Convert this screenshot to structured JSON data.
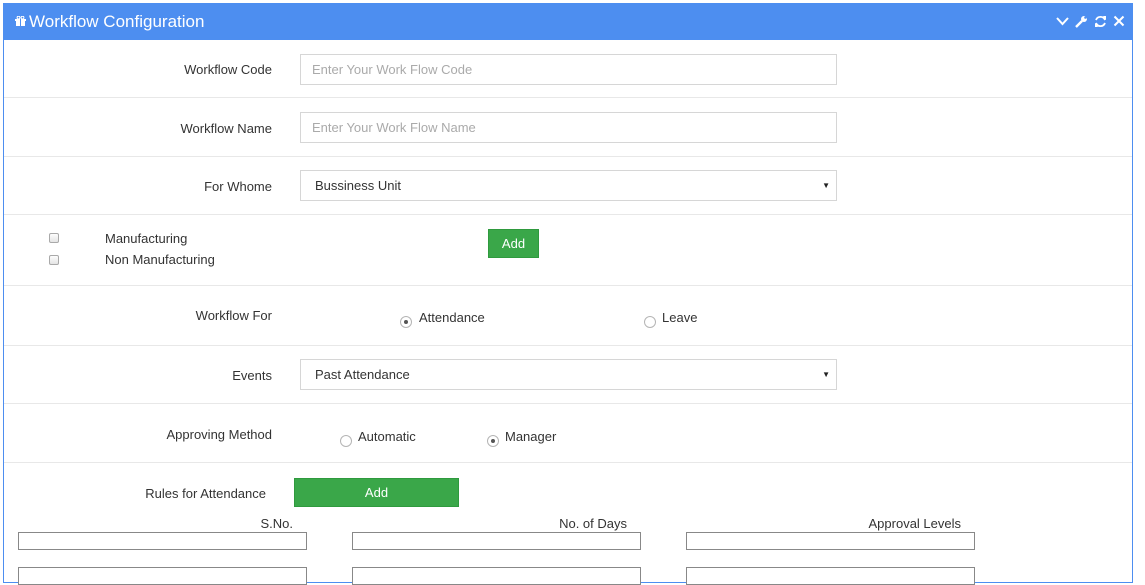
{
  "panel": {
    "title": "Workflow Configuration",
    "icon": "gift-icon",
    "tools": [
      "collapse-icon",
      "wrench-icon",
      "refresh-icon",
      "close-icon"
    ]
  },
  "form": {
    "workflow_code": {
      "label": "Workflow Code",
      "placeholder": "Enter Your Work Flow Code",
      "value": ""
    },
    "workflow_name": {
      "label": "Workflow Name",
      "placeholder": "Enter Your Work Flow Name",
      "value": ""
    },
    "for_whome": {
      "label": "For Whome",
      "selected": "Bussiness Unit"
    },
    "units": {
      "options": [
        {
          "label": "Manufacturing",
          "checked": false
        },
        {
          "label": "Non Manufacturing",
          "checked": false
        }
      ],
      "add_label": "Add"
    },
    "workflow_for": {
      "label": "Workflow For",
      "options": [
        {
          "label": "Attendance",
          "selected": true
        },
        {
          "label": "Leave",
          "selected": false
        }
      ]
    },
    "events": {
      "label": "Events",
      "selected": "Past Attendance"
    },
    "approving_method": {
      "label": "Approving Method",
      "options": [
        {
          "label": "Automatic",
          "selected": false
        },
        {
          "label": "Manager",
          "selected": true
        }
      ]
    },
    "rules": {
      "label": "Rules for Attendance",
      "add_label": "Add",
      "columns": [
        "S.No.",
        "No. of Days",
        "Approval Levels"
      ]
    }
  },
  "colors": {
    "header": "#4d8ef0",
    "button": "#3aa749"
  }
}
